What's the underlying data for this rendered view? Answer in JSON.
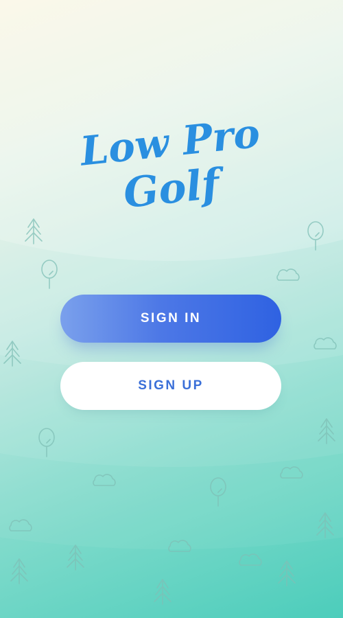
{
  "app": {
    "logo_line1": "Low Pro",
    "logo_line2": "Golf"
  },
  "buttons": {
    "sign_in": "SIGN IN",
    "sign_up": "SIGN UP"
  },
  "colors": {
    "brand_blue": "#2a8fe0",
    "primary_button": "#4d78e6",
    "secondary_button_text": "#3a6fd8"
  },
  "icons": [
    "pine-tree-icon",
    "round-tree-icon",
    "cloud-icon"
  ]
}
